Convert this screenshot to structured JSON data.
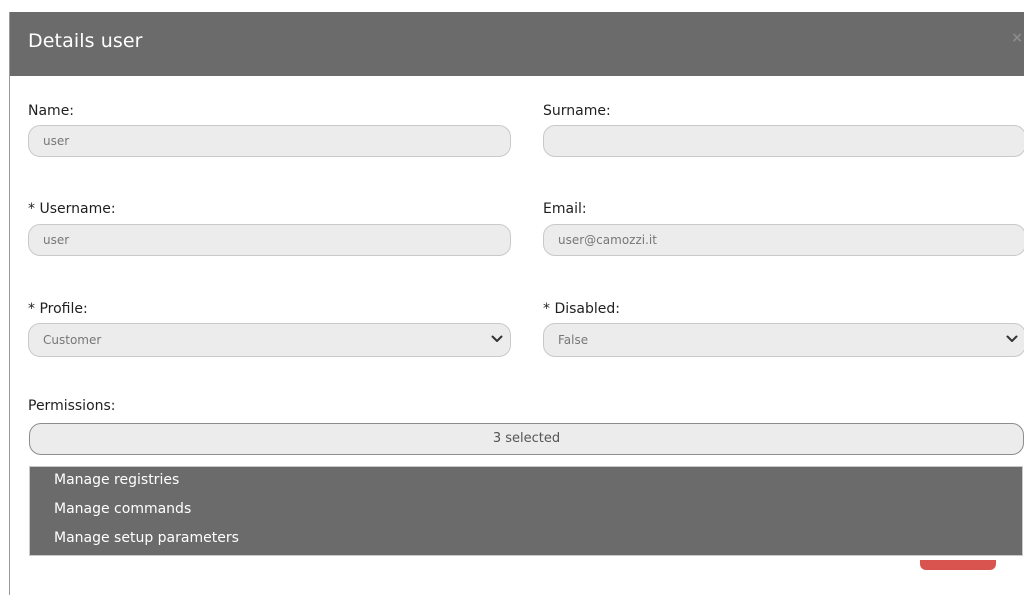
{
  "modal": {
    "title": "Details user",
    "close_glyph": "×"
  },
  "form": {
    "name": {
      "label": "Name:",
      "value": "user"
    },
    "surname": {
      "label": "Surname:",
      "value": ""
    },
    "username": {
      "label": "* Username:",
      "value": "user"
    },
    "email": {
      "label": "Email:",
      "value": "user@camozzi.it"
    },
    "profile": {
      "label": "* Profile:",
      "value": "Customer"
    },
    "disabled": {
      "label": "* Disabled:",
      "value": "False"
    },
    "permissions": {
      "label": "Permissions:",
      "summary": "3 selected",
      "options": [
        "Manage registries",
        "Manage commands",
        "Manage setup parameters"
      ]
    }
  },
  "colors": {
    "header": "#6b6b6b",
    "field_bg": "#ececec",
    "dropdown_bg": "#6b6b6b",
    "danger": "#d9534f"
  },
  "icons": {
    "close": "close-icon",
    "chevron": "chevron-down-icon"
  }
}
